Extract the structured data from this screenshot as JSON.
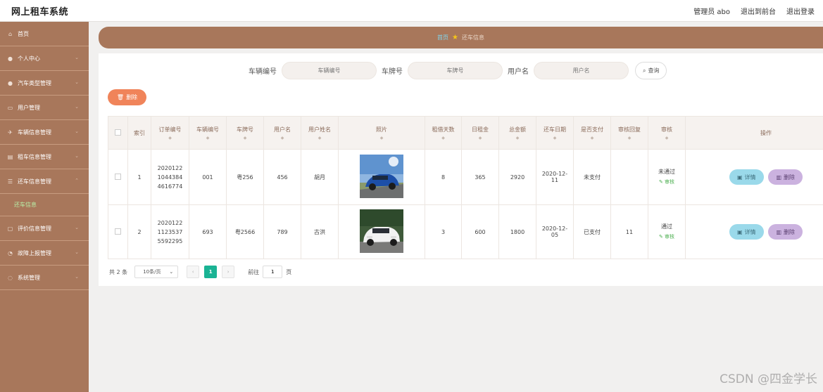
{
  "app": {
    "title": "网上租车系统",
    "user_label": "管理员 abo",
    "back_to_front": "退出到前台",
    "logout": "退出登录"
  },
  "sidebar": {
    "items": [
      {
        "label": "首页",
        "icon": "home-icon"
      },
      {
        "label": "个人中心",
        "icon": "user-icon"
      },
      {
        "label": "汽车类型管理",
        "icon": "user-icon"
      },
      {
        "label": "用户管理",
        "icon": "folder-icon"
      },
      {
        "label": "车辆信息管理",
        "icon": "car-icon"
      },
      {
        "label": "租车信息管理",
        "icon": "building-icon"
      },
      {
        "label": "还车信息管理",
        "icon": "list-icon"
      },
      {
        "label": "评价信息管理",
        "icon": "comment-icon"
      },
      {
        "label": "故障上报管理",
        "icon": "warning-icon"
      },
      {
        "label": "系统管理",
        "icon": "settings-icon"
      }
    ],
    "submenu": {
      "label": "还车信息"
    }
  },
  "breadcrumb": {
    "home": "首页",
    "current": "还车信息"
  },
  "search": {
    "vehicle_no_label": "车辆编号",
    "vehicle_no_placeholder": "车辆编号",
    "plate_label": "车牌号",
    "plate_placeholder": "车牌号",
    "username_label": "用户名",
    "username_placeholder": "用户名",
    "query_button": "查询"
  },
  "actions": {
    "delete_button": "删除"
  },
  "table": {
    "headers": [
      "索引",
      "订单编号",
      "车辆编号",
      "车牌号",
      "用户名",
      "用户姓名",
      "照片",
      "租借天数",
      "日租金",
      "总金额",
      "还车日期",
      "是否支付",
      "审核回复",
      "审核",
      "操作"
    ],
    "rows": [
      {
        "index": "1",
        "order_no_lines": [
          "2020122",
          "1044384",
          "4616774"
        ],
        "vehicle_no": "001",
        "plate": "粤256",
        "username": "456",
        "name": "胡月",
        "days": "8",
        "daily_rent": "365",
        "total": "2920",
        "return_date_lines": [
          "2020-12-",
          "11"
        ],
        "paid": "未支付",
        "reply": "",
        "audit_status": "未通过",
        "audit_link": "审核",
        "detail_button": "详情",
        "delete_button": "删除"
      },
      {
        "index": "2",
        "order_no_lines": [
          "2020122",
          "1123537",
          "5592295"
        ],
        "vehicle_no": "693",
        "plate": "粤2566",
        "username": "789",
        "name": "古洪",
        "days": "3",
        "daily_rent": "600",
        "total": "1800",
        "return_date_lines": [
          "2020-12-",
          "05"
        ],
        "paid": "已支付",
        "reply": "11",
        "audit_status": "通过",
        "audit_link": "审核",
        "detail_button": "详情",
        "delete_button": "删除"
      }
    ]
  },
  "pagination": {
    "total_text": "共 2 条",
    "page_size": "10条/页",
    "current_page": "1",
    "goto_label": "前往",
    "goto_value": "1",
    "page_suffix": "页"
  },
  "watermark": "CSDN @四金学长",
  "colors": {
    "sidebar_bg": "#a8775b",
    "delete_orange": "#f0845a",
    "detail_blue": "#9ad9ea",
    "delete_purple": "#cbb2df",
    "pager_active": "#1ab394"
  }
}
